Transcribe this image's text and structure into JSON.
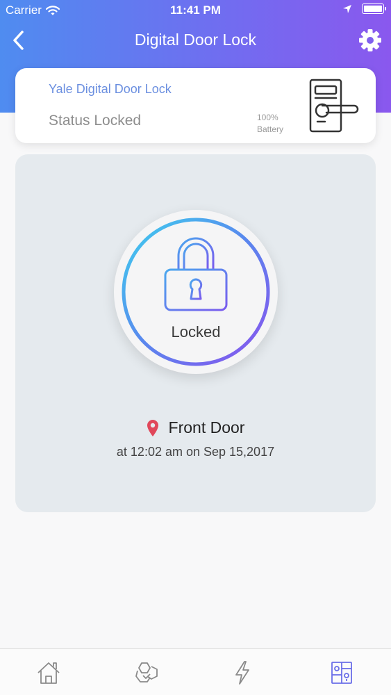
{
  "status_bar": {
    "carrier": "Carrier",
    "time": "11:41 PM",
    "icons": [
      "wifi-icon",
      "location-arrow-icon",
      "battery-icon"
    ]
  },
  "nav": {
    "title": "Digital Door Lock",
    "back_icon": "chevron-left-icon",
    "settings_icon": "gear-icon"
  },
  "device": {
    "name": "Yale Digital Door Lock",
    "status": "Status Locked",
    "battery_value": "100%",
    "battery_label": "Battery",
    "illustration_icon": "door-lock-handle-icon"
  },
  "lock_control": {
    "state_label": "Locked",
    "icon": "padlock-icon"
  },
  "location": {
    "name": "Front Door",
    "timestamp": "at 12:02 am on Sep 15,2017",
    "icon": "map-pin-icon"
  },
  "tab_bar": {
    "tabs": [
      {
        "icon": "home-icon",
        "active": false
      },
      {
        "icon": "devices-hex-icon",
        "active": false
      },
      {
        "icon": "lightning-icon",
        "active": false
      },
      {
        "icon": "door-lock-panel-icon",
        "active": true
      }
    ]
  },
  "colors": {
    "gradient_start": "#4f8cf0",
    "gradient_end": "#8a58ee",
    "device_name": "#6b8fe0",
    "pin": "#e0475a",
    "active_tab": "#6b6fe8"
  }
}
